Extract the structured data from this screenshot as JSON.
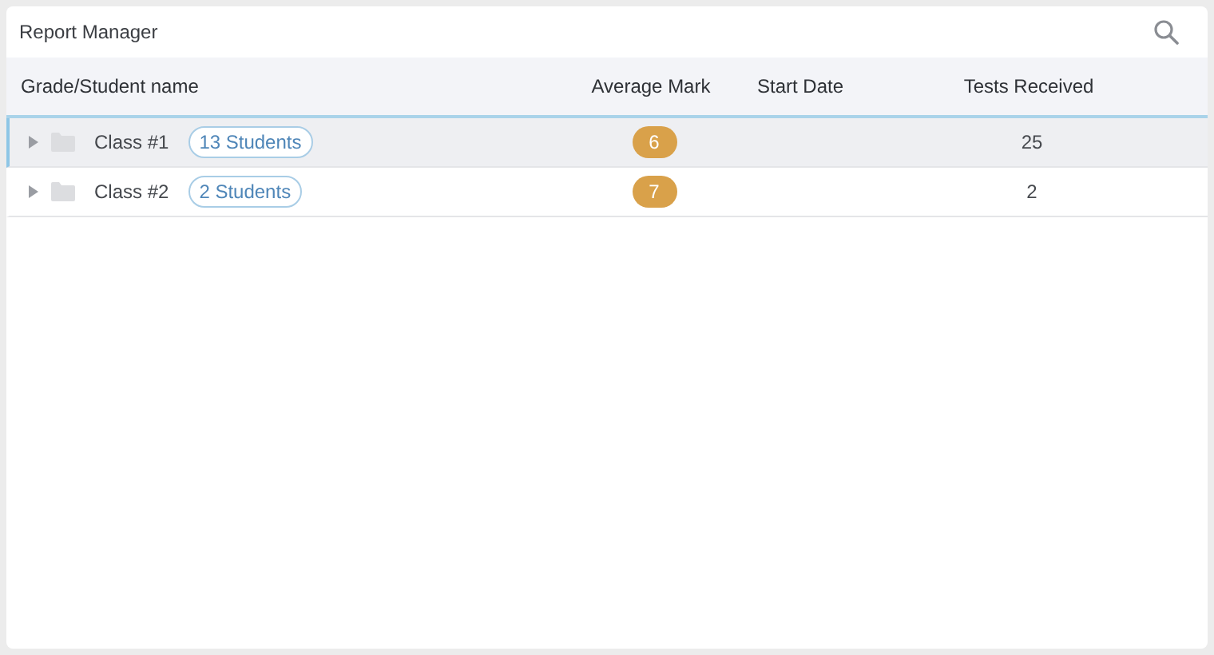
{
  "window": {
    "title": "Report Manager"
  },
  "table": {
    "columns": [
      "Grade/Student name",
      "Average Mark",
      "Start Date",
      "Tests Received"
    ],
    "rows": [
      {
        "name": "Class #1",
        "badge": "13 Students",
        "average_mark": "6",
        "tests_received": "25",
        "selected": true,
        "expanded": false
      },
      {
        "name": "Class #2",
        "badge": "2 Students",
        "average_mark": "7",
        "tests_received": "2",
        "selected": false,
        "expanded": false
      }
    ]
  }
}
